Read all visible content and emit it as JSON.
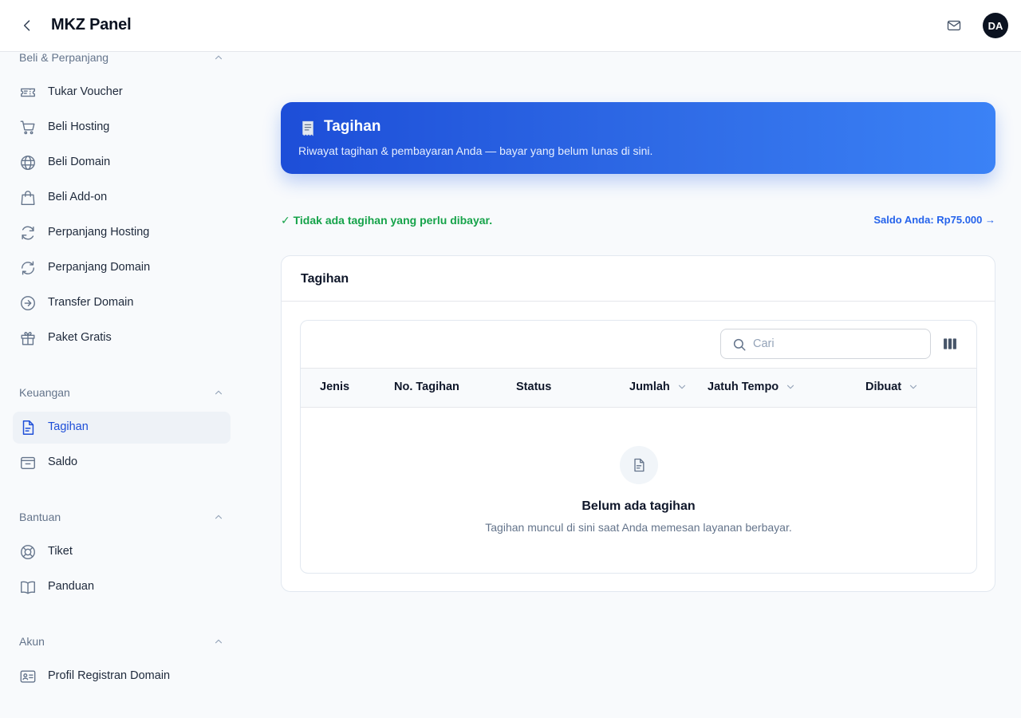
{
  "app": {
    "title": "MKZ Panel",
    "avatar_initials": "DA"
  },
  "sidebar": {
    "groups": [
      {
        "label": "Beli & Perpanjang",
        "items": [
          {
            "label": "Tukar Voucher",
            "icon": "ticket-icon"
          },
          {
            "label": "Beli Hosting",
            "icon": "cart-icon"
          },
          {
            "label": "Beli Domain",
            "icon": "globe-icon"
          },
          {
            "label": "Beli Add-on",
            "icon": "shopping-bag-icon"
          },
          {
            "label": "Perpanjang Hosting",
            "icon": "refresh-icon"
          },
          {
            "label": "Perpanjang Domain",
            "icon": "refresh-cycle-icon"
          },
          {
            "label": "Transfer Domain",
            "icon": "arrow-right-circle-icon"
          },
          {
            "label": "Paket Gratis",
            "icon": "gift-icon"
          }
        ]
      },
      {
        "label": "Keuangan",
        "items": [
          {
            "label": "Tagihan",
            "icon": "document-icon",
            "active": true
          },
          {
            "label": "Saldo",
            "icon": "wallet-icon"
          }
        ]
      },
      {
        "label": "Bantuan",
        "items": [
          {
            "label": "Tiket",
            "icon": "lifebuoy-icon"
          },
          {
            "label": "Panduan",
            "icon": "book-icon"
          }
        ]
      },
      {
        "label": "Akun",
        "items": [
          {
            "label": "Profil Registran Domain",
            "icon": "id-card-icon"
          }
        ]
      }
    ]
  },
  "hero": {
    "icon": "receipt-icon",
    "title": "Tagihan",
    "subtitle": "Riwayat tagihan & pembayaran Anda — bayar yang belum lunas di sini."
  },
  "status": {
    "message": "✓ Tidak ada tagihan yang perlu dibayar.",
    "saldo_link": "Saldo Anda: Rp75.000 →",
    "ok_color": "#16a34a",
    "link_color": "#2563eb"
  },
  "card": {
    "title": "Tagihan",
    "search": {
      "placeholder": "Cari",
      "value": ""
    },
    "columns": [
      {
        "label": "Jenis",
        "sortable": false
      },
      {
        "label": "No. Tagihan",
        "sortable": false
      },
      {
        "label": "Status",
        "sortable": false
      },
      {
        "label": "Jumlah",
        "sortable": true
      },
      {
        "label": "Jatuh Tempo",
        "sortable": true
      },
      {
        "label": "Dibuat",
        "sortable": true
      }
    ],
    "empty": {
      "title": "Belum ada tagihan",
      "subtitle": "Tagihan muncul di sini saat Anda memesan layanan berbayar."
    }
  },
  "colors": {
    "accent": "#1d4ed8",
    "hero_start": "#1d4ed8",
    "hero_end": "#3b82f6"
  }
}
